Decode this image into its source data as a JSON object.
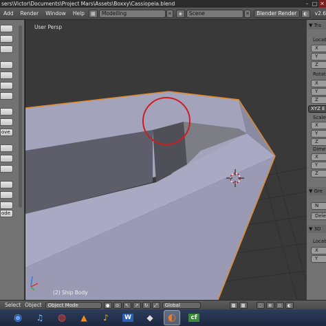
{
  "window": {
    "title": "sers\\Victor\\Documents\\Project Mars\\Assets\\Boxxy\\Cassiopeia.blend",
    "controls": [
      "–",
      "□",
      "✕"
    ]
  },
  "info_header": {
    "menus": [
      "Add",
      "Render",
      "Window",
      "Help"
    ],
    "screen_layout": "Modelling",
    "scene": "Scene",
    "render_engine": "Blender Render",
    "version": "v2.6"
  },
  "toolshelf": {
    "buttons": [
      "",
      "",
      "",
      "",
      "",
      "",
      "",
      "",
      "",
      "",
      "ove",
      "",
      "",
      "",
      "",
      "",
      "",
      "",
      "ode",
      ""
    ]
  },
  "viewport": {
    "view_label": "User Persp",
    "object_label": "(2) Ship Body"
  },
  "properties": {
    "transform_header": "▼ Tra",
    "location_label": "Locati",
    "location_fields": [
      "X",
      "Y",
      "Z"
    ],
    "rotation_label": "Rotatio",
    "rotation_fields": [
      "X",
      "Y",
      "Z"
    ],
    "rotation_mode": "XYZ E",
    "scale_label": "Scale",
    "scale_fields": [
      "X",
      "Y",
      "Z"
    ],
    "dimensions_label": "Dime",
    "dimensions_fields": [
      "X",
      "Y",
      "Z"
    ],
    "grease_header": "▼ Gre",
    "grease_new": "N",
    "grease_delete": "Delete",
    "view_header": "▼ 3D",
    "view_location_label": "Locat",
    "view_cursor_fields": [
      "X",
      "Y"
    ]
  },
  "view3d_header": {
    "menus": [
      "Select",
      "Object"
    ],
    "mode": "Object Mode",
    "orientation": "Global"
  },
  "taskbar": {
    "apps": [
      {
        "name": "start-orb",
        "glyph": "◉",
        "color": "#3f7fd2"
      },
      {
        "name": "itunes",
        "glyph": "♫",
        "color": "#4a9de0"
      },
      {
        "name": "chrome",
        "glyph": "◍",
        "color": "#d9432f"
      },
      {
        "name": "vlc",
        "glyph": "▲",
        "color": "#f08a1c"
      },
      {
        "name": "fruity",
        "glyph": "♪",
        "color": "#e0a020"
      },
      {
        "name": "word",
        "glyph": "W",
        "color": "#2b5fb0"
      },
      {
        "name": "unity",
        "glyph": "◆",
        "color": "#5a5a5a"
      },
      {
        "name": "blender",
        "glyph": "◐",
        "color": "#e07020"
      },
      {
        "name": "cf",
        "glyph": "cf",
        "color": "#3a8a3a"
      }
    ]
  },
  "colors": {
    "viewport_bg": "#393939",
    "mesh_face": "#9c9cb6",
    "selection_outline": "#e0892a",
    "annotation_circle": "#d01c1c"
  }
}
